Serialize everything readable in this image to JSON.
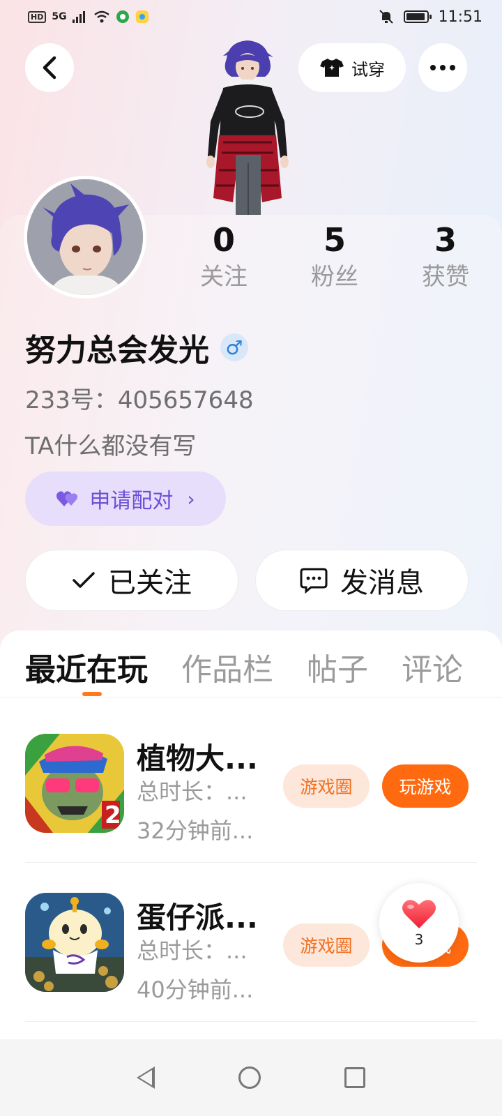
{
  "status_bar": {
    "network": "HD",
    "signal": "5G",
    "time": "11:51"
  },
  "header": {
    "back_icon": "chevron-left-icon",
    "tryon_label": "试穿",
    "tryon_icon": "tshirt-icon",
    "more_icon": "more-dots-icon"
  },
  "profile": {
    "stats": [
      {
        "value": "0",
        "label": "关注"
      },
      {
        "value": "5",
        "label": "粉丝"
      },
      {
        "value": "3",
        "label": "获赞"
      }
    ],
    "name": "努力总会发光",
    "gender_symbol": "♂",
    "user_id": "233号：405657648",
    "bio": "TA什么都没有写",
    "pair_button": "申请配对",
    "pair_chevron": "›",
    "follow_button": "已关注",
    "message_button": "发消息"
  },
  "tabs": [
    {
      "label": "最近在玩",
      "active": true
    },
    {
      "label": "作品栏",
      "active": false
    },
    {
      "label": "帖子",
      "active": false
    },
    {
      "label": "评论",
      "active": false
    }
  ],
  "games": [
    {
      "title": "植物大...",
      "duration": "总时长：...",
      "last_played": "32分钟前...",
      "circle_label": "游戏圈",
      "play_label": "玩游戏"
    },
    {
      "title": "蛋仔派...",
      "duration": "总时长：...",
      "last_played": "40分钟前...",
      "circle_label": "游戏圈",
      "play_label": "玩游戏"
    }
  ],
  "like_widget": {
    "count": "3",
    "icon": "heart-icon"
  },
  "colors": {
    "accent_orange": "#ff6a10",
    "pair_purple": "#6d4fd6",
    "gender_blue": "#2f7fd6"
  }
}
